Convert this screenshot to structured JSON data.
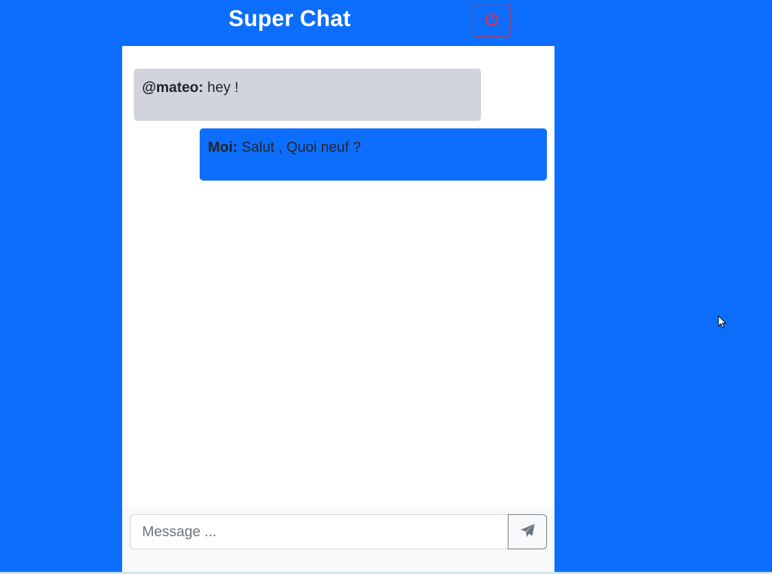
{
  "header": {
    "title": "Super Chat"
  },
  "messages": [
    {
      "sender": "@mateo:",
      "text": " hey !",
      "direction": "incoming"
    },
    {
      "sender": "Moi:",
      "text": " Salut , Quoi neuf ?",
      "direction": "outgoing"
    }
  ],
  "composer": {
    "placeholder": "Message ...",
    "value": ""
  },
  "icons": {
    "logout": "power-icon",
    "send": "paper-plane-icon",
    "cursor": "mouse-pointer-icon"
  },
  "colors": {
    "background": "#0d6efd",
    "incoming_bubble": "#d1d5db",
    "outgoing_bubble": "#0d6efd",
    "logout_accent": "#dc3545"
  }
}
